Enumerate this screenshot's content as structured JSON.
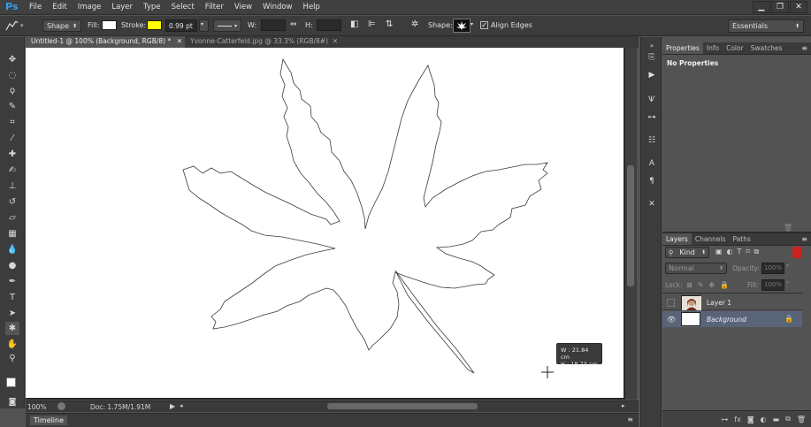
{
  "app": {
    "logo": "Ps",
    "menus": [
      "File",
      "Edit",
      "Image",
      "Layer",
      "Type",
      "Select",
      "Filter",
      "View",
      "Window",
      "Help"
    ],
    "window_controls": [
      "▁",
      "❐",
      "✕"
    ]
  },
  "options": {
    "mode": "Shape",
    "fill_label": "Fill:",
    "fill_color": "#ffffff",
    "stroke_label": "Stroke:",
    "stroke_color": "#ffff00",
    "stroke_width": "0.99 pt",
    "w_label": "W:",
    "h_label": "H:",
    "shape_label": "Shape:",
    "align_edges_label": "Align Edges",
    "workspace": "Essentials"
  },
  "tabs": [
    {
      "label": "Untitled-1 @ 100% (Background, RGB/8) *",
      "active": true
    },
    {
      "label": "Yvonne-Catterfeld.jpg @ 33.3% (RGB/8#)",
      "active": false
    }
  ],
  "readout": {
    "w": "W :   21.84 cm",
    "h": "H :   18.73 cm"
  },
  "status": {
    "zoom": "100%",
    "doc": "Doc: 1.75M/1.91M"
  },
  "timeline_label": "Timeline",
  "properties": {
    "tabs": [
      "Properties",
      "Info",
      "Color",
      "Swatches"
    ],
    "content": "No Properties"
  },
  "layers_panel": {
    "tabs": [
      "Layers",
      "Channels",
      "Paths"
    ],
    "filter_kind": "Kind",
    "blend_mode": "Normal",
    "opacity_label": "Opacity:",
    "opacity_value": "100%",
    "lock_label": "Lock:",
    "fill_label": "Fill:",
    "fill_value": "100%",
    "layers": [
      {
        "name": "Layer 1",
        "selected": false
      },
      {
        "name": "Background",
        "selected": true
      }
    ]
  },
  "colors": {
    "accent": "#2fa1f2",
    "selected_layer": "#5a6478"
  }
}
